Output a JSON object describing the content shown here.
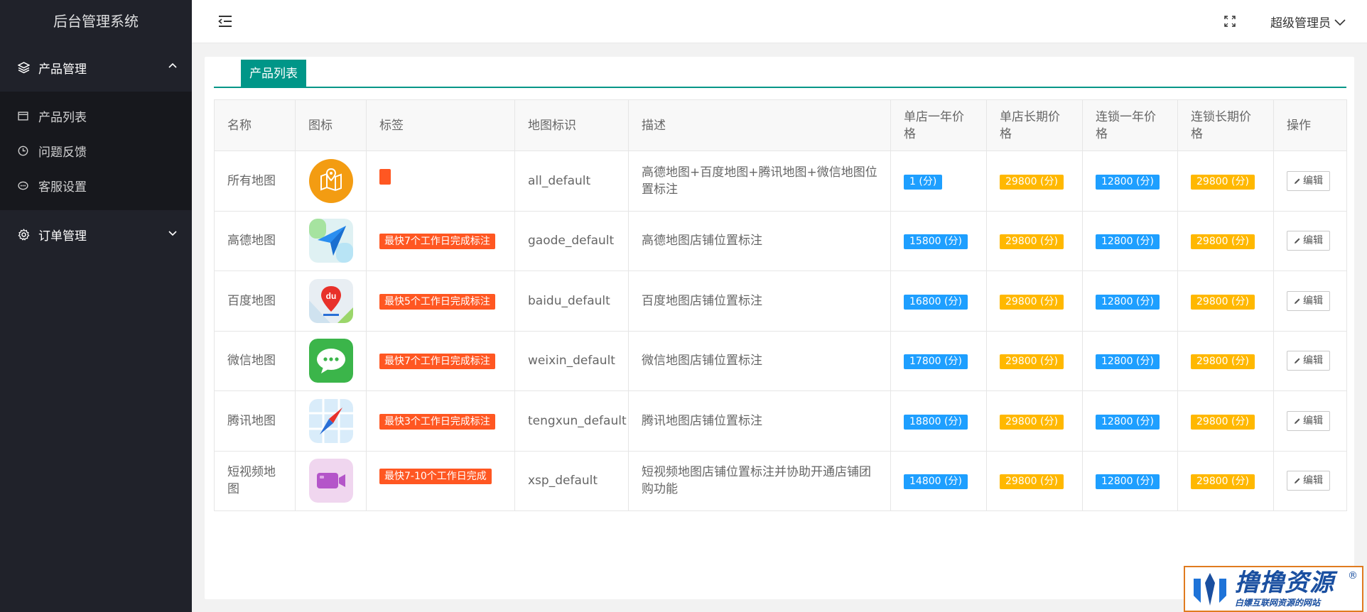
{
  "app": {
    "title": "后台管理系统"
  },
  "sidebar": {
    "groups": [
      {
        "label": "产品管理",
        "icon": "layers-icon",
        "expanded": true,
        "items": [
          {
            "label": "产品列表",
            "icon": "list-icon"
          },
          {
            "label": "问题反馈",
            "icon": "clock-icon"
          },
          {
            "label": "客服设置",
            "icon": "chat-icon"
          }
        ]
      },
      {
        "label": "订单管理",
        "icon": "gear-icon",
        "expanded": false,
        "items": []
      }
    ]
  },
  "header": {
    "user": "超级管理员"
  },
  "tabs": [
    {
      "label": "产品列表",
      "active": true
    }
  ],
  "table": {
    "headers": [
      "名称",
      "图标",
      "标签",
      "地图标识",
      "描述",
      "单店一年价格",
      "单店长期价格",
      "连锁一年价格",
      "连锁长期价格",
      "操作"
    ],
    "rows": [
      {
        "name": "所有地图",
        "icon": "all-maps-icon",
        "tag": "",
        "key": "all_default",
        "desc": "高德地图+百度地图+腾讯地图+微信地图位置标注",
        "p1": "1 (分)",
        "p2": "29800 (分)",
        "p3": "12800 (分)",
        "p4": "29800 (分)",
        "action": "编辑"
      },
      {
        "name": "高德地图",
        "icon": "gaode-icon",
        "tag": "最快7个工作日完成标注",
        "key": "gaode_default",
        "desc": "高德地图店铺位置标注",
        "p1": "15800 (分)",
        "p2": "29800 (分)",
        "p3": "12800 (分)",
        "p4": "29800 (分)",
        "action": "编辑"
      },
      {
        "name": "百度地图",
        "icon": "baidu-icon",
        "tag": "最快5个工作日完成标注",
        "key": "baidu_default",
        "desc": "百度地图店铺位置标注",
        "p1": "16800 (分)",
        "p2": "29800 (分)",
        "p3": "12800 (分)",
        "p4": "29800 (分)",
        "action": "编辑"
      },
      {
        "name": "微信地图",
        "icon": "wechat-icon",
        "tag": "最快7个工作日完成标注",
        "key": "weixin_default",
        "desc": "微信地图店铺位置标注",
        "p1": "17800 (分)",
        "p2": "29800 (分)",
        "p3": "12800 (分)",
        "p4": "29800 (分)",
        "action": "编辑"
      },
      {
        "name": "腾讯地图",
        "icon": "tencent-icon",
        "tag": "最快3个工作日完成标注",
        "key": "tengxun_default",
        "desc": "腾讯地图店铺位置标注",
        "p1": "18800 (分)",
        "p2": "29800 (分)",
        "p3": "12800 (分)",
        "p4": "29800 (分)",
        "action": "编辑"
      },
      {
        "name": "短视频地图",
        "icon": "video-icon",
        "tag": "最快7-10个工作日完成",
        "key": "xsp_default",
        "desc": "短视频地图店铺位置标注并协助开通店铺团购功能",
        "p1": "14800 (分)",
        "p2": "29800 (分)",
        "p3": "12800 (分)",
        "p4": "29800 (分)",
        "action": "编辑"
      }
    ]
  },
  "watermark": {
    "main": "撸撸资源",
    "sub": "白嫖互联网资源的网站",
    "mark": "®"
  },
  "colors": {
    "sidebar": "#20222a",
    "accent": "#009688",
    "tag": "#ff5722",
    "blue_badge": "#1e9fff",
    "orange_badge": "#ffb800"
  }
}
